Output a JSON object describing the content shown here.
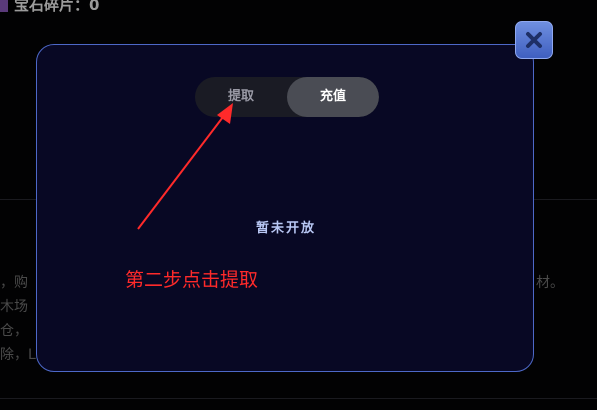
{
  "background": {
    "top_label": "宝石碎片：0",
    "lines_left": [
      "，购",
      "木场",
      "仓，",
      "除，L"
    ],
    "line_right": "材。"
  },
  "modal": {
    "tabs": [
      {
        "label": "提取"
      },
      {
        "label": "充值"
      }
    ],
    "active_tab": "充值",
    "empty_message": "暂未开放"
  },
  "annotation": {
    "text": "第二步点击提取",
    "color": "#ff2a2a"
  },
  "colors": {
    "modal_bg": "#080824",
    "modal_border": "#4d68c8",
    "accent": "#4f70d0"
  },
  "icons": {
    "close": "close-icon",
    "gem": "gem-icon"
  }
}
